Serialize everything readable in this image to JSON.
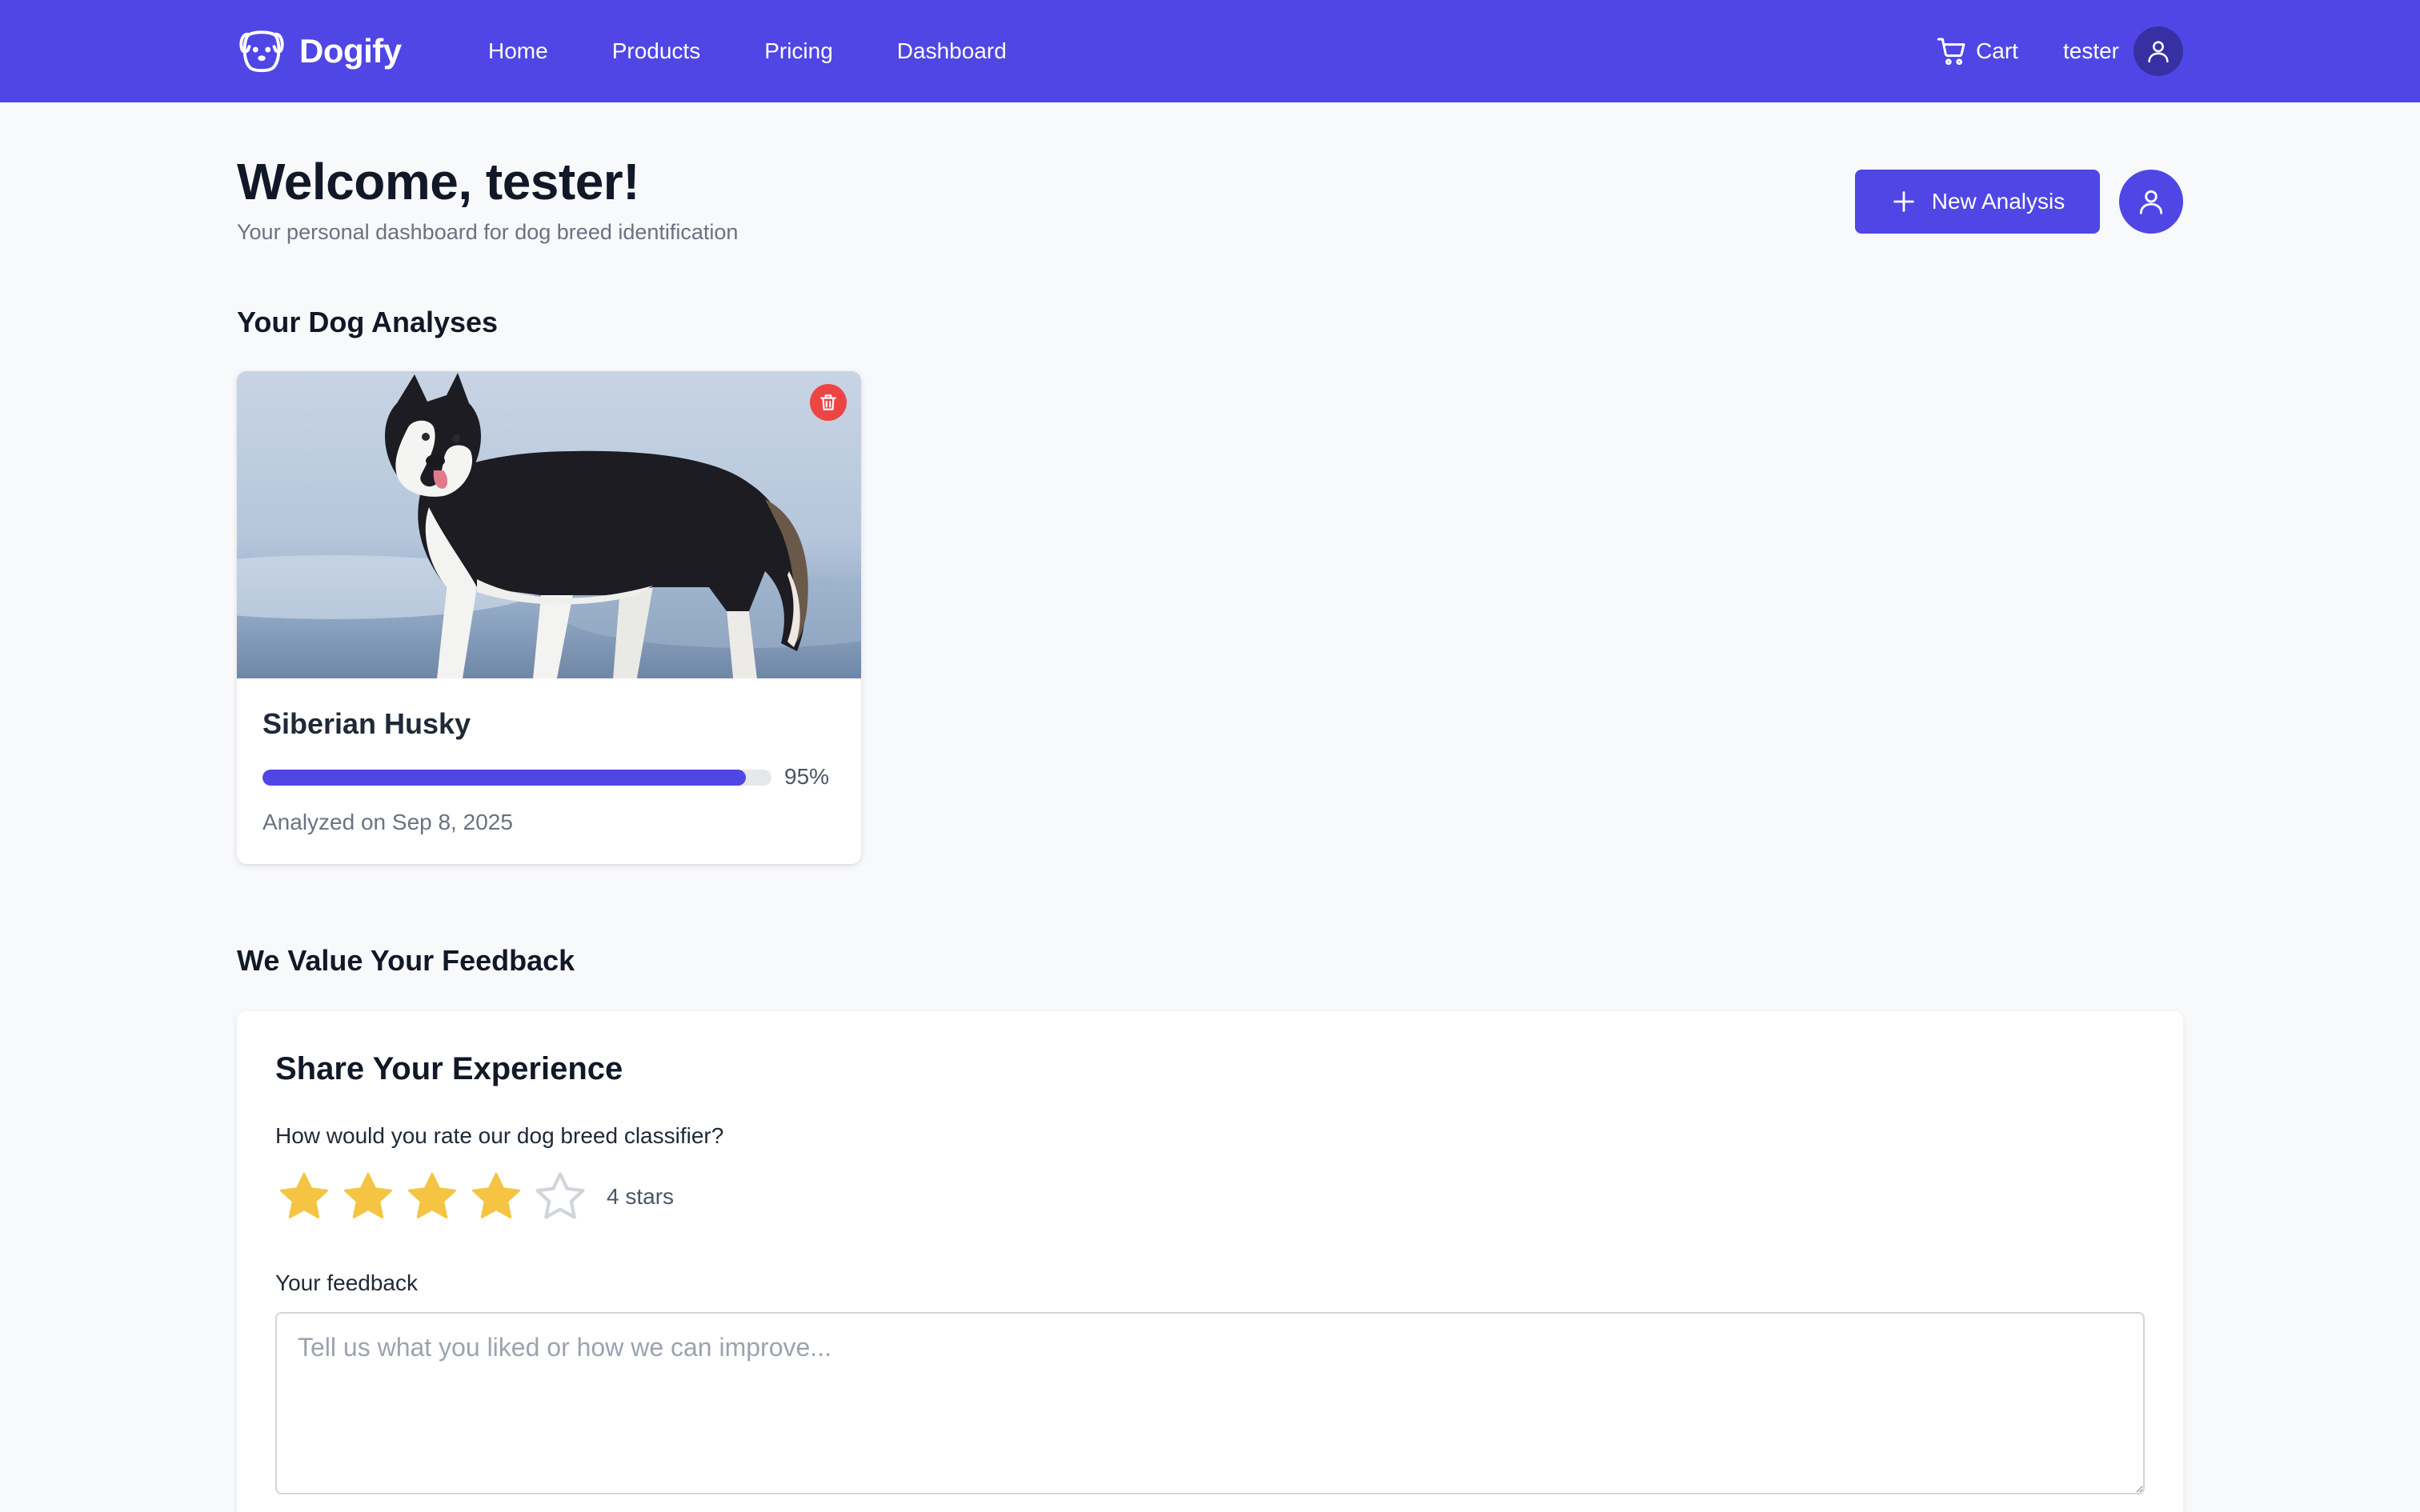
{
  "nav": {
    "brand": "Dogify",
    "brand_icon": "dog-face-icon",
    "links": [
      "Home",
      "Products",
      "Pricing",
      "Dashboard"
    ],
    "cart_label": "Cart",
    "cart_icon": "cart-icon",
    "user_name": "tester",
    "avatar_icon": "user-icon"
  },
  "header": {
    "title": "Welcome, tester!",
    "subtitle": "Your personal dashboard for dog breed identification",
    "new_analysis_label": "New Analysis",
    "new_analysis_icon": "plus-icon",
    "profile_icon": "user-icon"
  },
  "analyses": {
    "section_title": "Your Dog Analyses",
    "items": [
      {
        "breed": "Siberian Husky",
        "confidence": 95,
        "confidence_label": "95%",
        "analyzed_on": "Analyzed on Sep 8, 2025",
        "delete_icon": "trash-icon"
      }
    ]
  },
  "feedback": {
    "section_title": "We Value Your Feedback",
    "card_title": "Share Your Experience",
    "rating_question": "How would you rate our dog breed classifier?",
    "rating": 4,
    "max_rating": 5,
    "rating_label": "4 stars",
    "feedback_label": "Your feedback",
    "feedback_value": "",
    "feedback_placeholder": "Tell us what you liked or how we can improve..."
  },
  "colors": {
    "brand": "#4f46e5",
    "brand_dark": "#3730a3",
    "danger": "#ef4444",
    "star_filled": "#f5c443",
    "star_empty": "#d1d5db",
    "page_bg": "#f8f9fb"
  }
}
